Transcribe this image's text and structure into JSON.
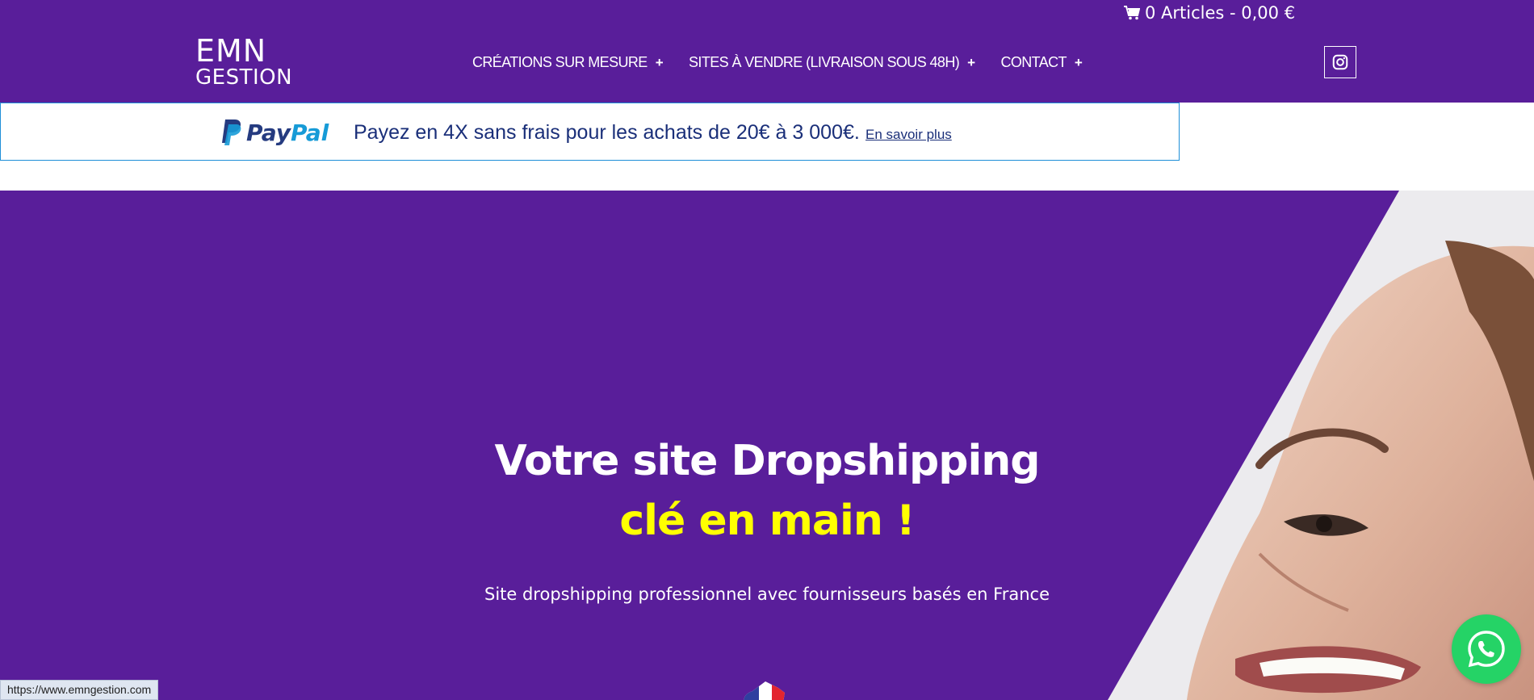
{
  "header": {
    "cart": "0 Articles - 0,00 €",
    "logo_top": "EMN",
    "logo_bottom": "GESTION",
    "nav": [
      {
        "label": "CRÉATIONS SUR MESURE"
      },
      {
        "label": "SITES À VENDRE (LIVRAISON SOUS 48H)"
      },
      {
        "label": "CONTACT"
      }
    ],
    "nav_plus": "+"
  },
  "paypal": {
    "logo_a": "Pay",
    "logo_b": "Pal",
    "message": "Payez en 4X sans frais pour les achats de 20€ à 3 000€.",
    "link": "En savoir plus"
  },
  "hero": {
    "title_line1": "Votre site Dropshipping",
    "title_line2": "clé en main !",
    "subtitle": "Site dropshipping professionnel avec fournisseurs basés en France"
  },
  "status_bar": {
    "url": "https://www.emngestion.com"
  },
  "icons": {
    "cart": "cart-icon",
    "instagram": "instagram-icon",
    "whatsapp": "whatsapp-icon",
    "flag": "france-flag-icon"
  },
  "colors": {
    "brand_purple": "#591e9a",
    "highlight_yellow": "#ffff00",
    "paypal_dark": "#253b80",
    "paypal_light": "#179bd7",
    "whatsapp_green": "#25d366"
  }
}
